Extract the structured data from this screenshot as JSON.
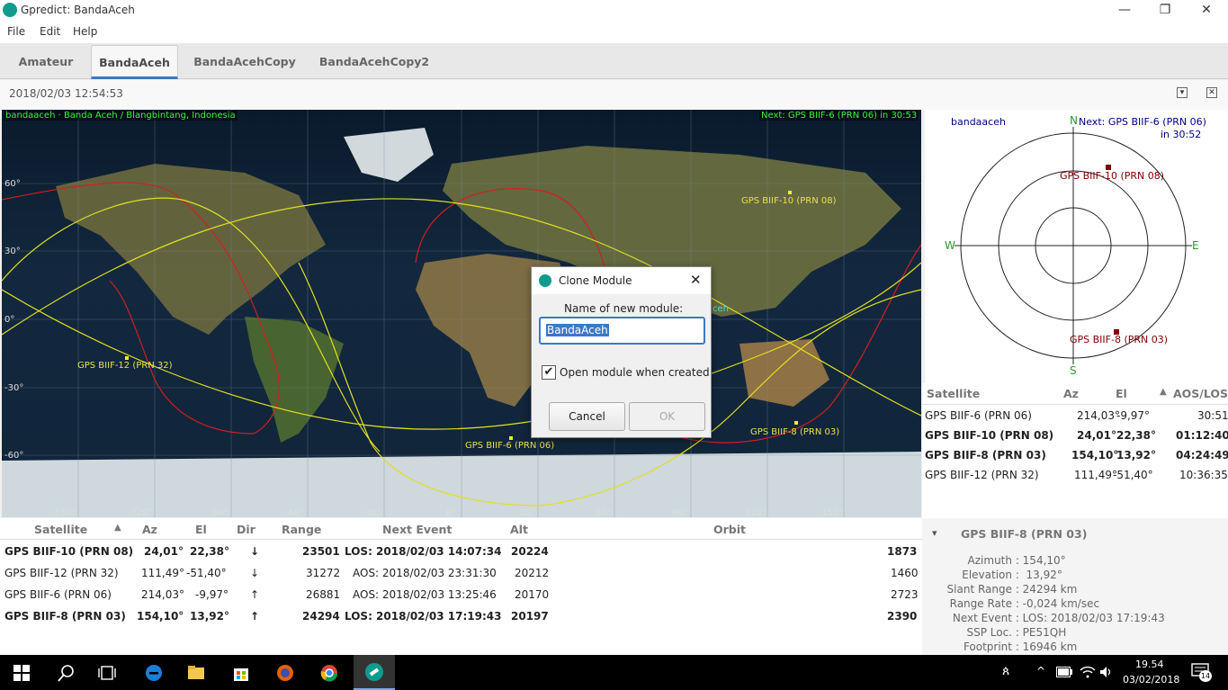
{
  "window": {
    "title": "Gpredict: BandaAceh",
    "minimize": "—",
    "restore": "❐",
    "close": "✕"
  },
  "menu": [
    "File",
    "Edit",
    "Help"
  ],
  "tabs": [
    "Amateur",
    "BandaAceh",
    "BandaAcehCopy",
    "BandaAcehCopy2"
  ],
  "header": {
    "datetime": "2018/02/03 12:54:53",
    "dropdown_icon": "▾",
    "close_icon": "✕"
  },
  "map": {
    "location_label": "bandaaceh · Banda Aceh / Blangbintang, Indonesia",
    "next_label": "Next: GPS BIIF-6  (PRN 06) in 30:53",
    "station_label": "ceh",
    "lat_ticks": [
      "60°",
      "30°",
      "0°",
      "-30°",
      "-60°"
    ],
    "lon_ticks": [
      "-150°",
      "-120°",
      "-90°",
      "-60°",
      "-30°",
      "0°",
      "30°",
      "60°",
      "90°",
      "120°",
      "150°"
    ],
    "sat_labels": [
      "GPS BIIF-10  (PRN 08)",
      "GPS BIIF-12  (PRN 32)",
      "GPS BIIF-6  (PRN 06)",
      "GPS BIIF-8  (PRN 03)"
    ]
  },
  "polar": {
    "station": "bandaaceh",
    "next_line1": "Next: GPS BIIF-6  (PRN 06)",
    "next_line2": "in 30:52",
    "n": "N",
    "s": "S",
    "e": "E",
    "w": "W",
    "sat1": "GPS BIIF-10  (PRN 08)",
    "sat2": "GPS BIIF-8  (PRN 03)"
  },
  "right_table": {
    "headers": [
      "Satellite",
      "Az",
      "El",
      "AOS/LOS"
    ],
    "sort_arrow": "▲",
    "rows": [
      {
        "name": "GPS BIIF-6  (PRN 06)",
        "az": "214,03°",
        "el": "-9,97°",
        "aos": "30:51",
        "bold": false
      },
      {
        "name": "GPS BIIF-10  (PRN 08)",
        "az": "24,01°",
        "el": "22,38°",
        "aos": "01:12:40",
        "bold": true
      },
      {
        "name": "GPS BIIF-8  (PRN 03)",
        "az": "154,10°",
        "el": "13,92°",
        "aos": "04:24:49",
        "bold": true
      },
      {
        "name": "GPS BIIF-12  (PRN 32)",
        "az": "111,49°",
        "el": "-51,40°",
        "aos": "10:36:35",
        "bold": false
      }
    ]
  },
  "bottom_table": {
    "headers": [
      "Satellite",
      "Az",
      "El",
      "Dir",
      "Range",
      "Next Event",
      "Alt",
      "Orbit"
    ],
    "sort_arrow": "▲",
    "rows": [
      {
        "name": "GPS BIIF-10  (PRN 08)",
        "az": "24,01°",
        "el": "22,38°",
        "dir": "↓",
        "range": "23501",
        "event": "LOS: 2018/02/03 14:07:34",
        "alt": "20224",
        "orbit": "1873",
        "bold": true
      },
      {
        "name": "GPS BIIF-12  (PRN 32)",
        "az": "111,49°",
        "el": "-51,40°",
        "dir": "↓",
        "range": "31272",
        "event": "AOS: 2018/02/03 23:31:30",
        "alt": "20212",
        "orbit": "1460",
        "bold": false
      },
      {
        "name": "GPS BIIF-6  (PRN 06)",
        "az": "214,03°",
        "el": "-9,97°",
        "dir": "↑",
        "range": "26881",
        "event": "AOS: 2018/02/03 13:25:46",
        "alt": "20170",
        "orbit": "2723",
        "bold": false
      },
      {
        "name": "GPS BIIF-8  (PRN 03)",
        "az": "154,10°",
        "el": "13,92°",
        "dir": "↑",
        "range": "24294",
        "event": "LOS: 2018/02/03 17:19:43",
        "alt": "20197",
        "orbit": "2390",
        "bold": true
      }
    ]
  },
  "info": {
    "title": "GPS BIIF-8  (PRN 03)",
    "toggle_icon": "▾",
    "rows": [
      {
        "label": "Azimuth",
        "value": "154,10°"
      },
      {
        "label": "Elevation",
        "value": "13,92°"
      },
      {
        "label": "Slant Range",
        "value": "24294 km"
      },
      {
        "label": "Range Rate",
        "value": "-0,024 km/sec"
      },
      {
        "label": "Next Event",
        "value": "LOS: 2018/02/03 17:19:43"
      },
      {
        "label": "SSP Loc.",
        "value": "PE51QH"
      },
      {
        "label": "Footprint",
        "value": "16946 km"
      }
    ]
  },
  "dialog": {
    "title": "Clone Module",
    "close": "✕",
    "label": "Name of new module:",
    "input_value": "BandaAceh",
    "checkbox_label": "Open module when created",
    "checked_mark": "✔",
    "cancel": "Cancel",
    "ok": "OK"
  },
  "taskbar": {
    "time": "19.54",
    "date": "03/02/2018",
    "notifications": "14"
  }
}
